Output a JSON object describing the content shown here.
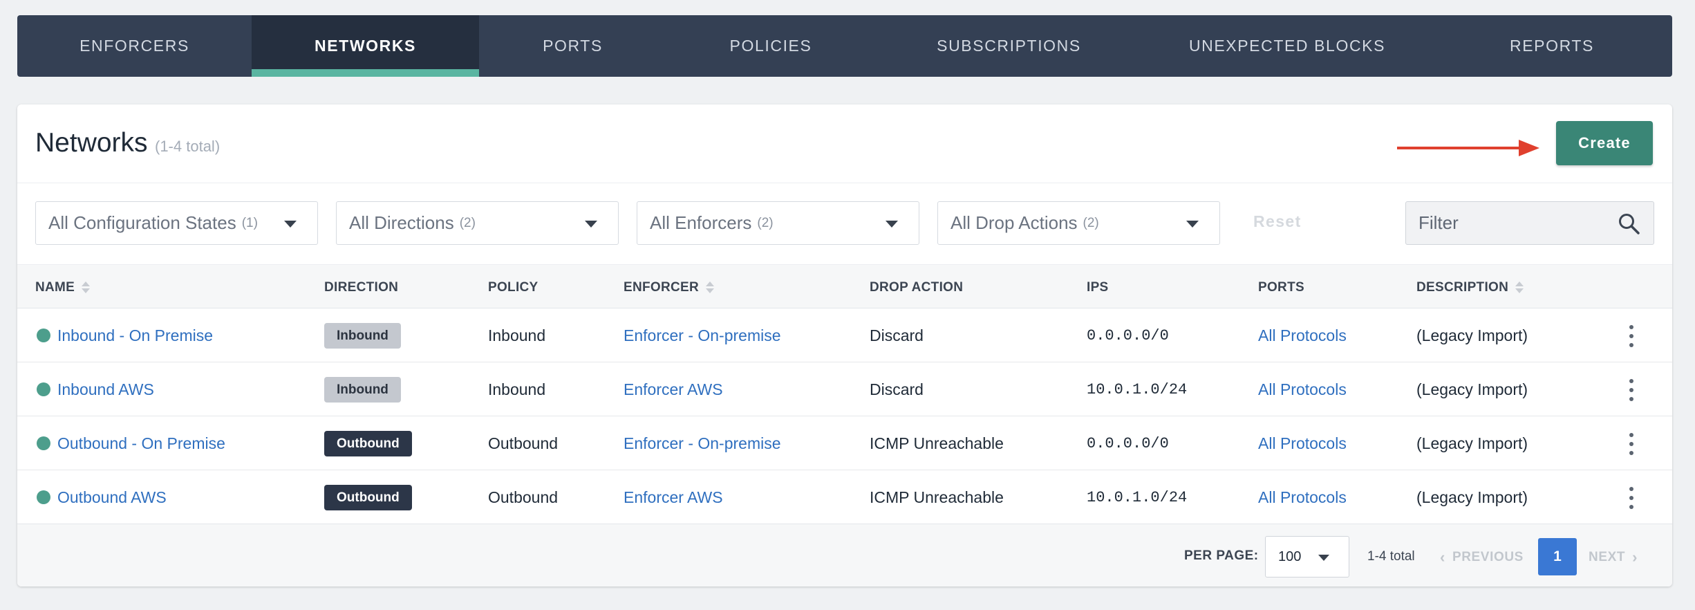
{
  "nav": {
    "tabs": [
      {
        "label": "ENFORCERS",
        "active": false
      },
      {
        "label": "NETWORKS",
        "active": true
      },
      {
        "label": "PORTS",
        "active": false
      },
      {
        "label": "POLICIES",
        "active": false
      },
      {
        "label": "SUBSCRIPTIONS",
        "active": false
      },
      {
        "label": "UNEXPECTED BLOCKS",
        "active": false
      },
      {
        "label": "REPORTS",
        "active": false
      }
    ]
  },
  "header": {
    "title": "Networks",
    "count": "(1-4 total)",
    "create_label": "Create"
  },
  "filters": {
    "config_states": {
      "label": "All Configuration States",
      "count": "(1)"
    },
    "directions": {
      "label": "All Directions",
      "count": "(2)"
    },
    "enforcers": {
      "label": "All Enforcers",
      "count": "(2)"
    },
    "drop_actions": {
      "label": "All Drop Actions",
      "count": "(2)"
    },
    "reset_label": "Reset",
    "search_placeholder": "Filter"
  },
  "table": {
    "columns": {
      "name": "NAME",
      "direction": "DIRECTION",
      "policy": "POLICY",
      "enforcer": "ENFORCER",
      "drop_action": "DROP ACTION",
      "ips": "IPS",
      "ports": "PORTS",
      "description": "DESCRIPTION"
    },
    "rows": [
      {
        "name": "Inbound - On Premise",
        "direction": "Inbound",
        "policy": "Inbound",
        "enforcer": "Enforcer - On-premise",
        "drop_action": "Discard",
        "ips": "0.0.0.0/0",
        "ports": "All Protocols",
        "description": "(Legacy Import)"
      },
      {
        "name": "Inbound AWS",
        "direction": "Inbound",
        "policy": "Inbound",
        "enforcer": "Enforcer AWS",
        "drop_action": "Discard",
        "ips": "10.0.1.0/24",
        "ports": "All Protocols",
        "description": "(Legacy Import)"
      },
      {
        "name": "Outbound - On Premise",
        "direction": "Outbound",
        "policy": "Outbound",
        "enforcer": "Enforcer - On-premise",
        "drop_action": "ICMP Unreachable",
        "ips": "0.0.0.0/0",
        "ports": "All Protocols",
        "description": "(Legacy Import)"
      },
      {
        "name": "Outbound AWS",
        "direction": "Outbound",
        "policy": "Outbound",
        "enforcer": "Enforcer AWS",
        "drop_action": "ICMP Unreachable",
        "ips": "10.0.1.0/24",
        "ports": "All Protocols",
        "description": "(Legacy Import)"
      }
    ]
  },
  "footer": {
    "per_page_label": "PER PAGE:",
    "per_page_value": "100",
    "total": "1-4 total",
    "previous_label": "PREVIOUS",
    "current_page": "1",
    "next_label": "NEXT"
  },
  "colors": {
    "nav_bg": "#344054",
    "nav_active_bg": "#252f3f",
    "nav_active_underline": "#5ab5a1",
    "create_button": "#3a8676",
    "link": "#2f6fbf",
    "status_dot": "#4d9e8c",
    "annotation_arrow": "#e0402e",
    "page_active": "#3a78d4"
  }
}
